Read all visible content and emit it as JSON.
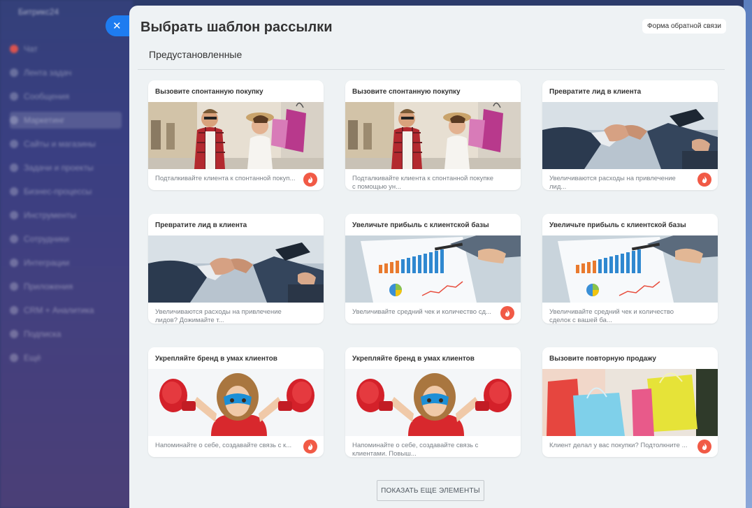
{
  "background_sidebar": {
    "title": "Битрикс24",
    "items": [
      "Чат",
      "Лента задач",
      "Сообщения",
      "Маркетинг",
      "Сайты и магазины",
      "Задачи и проекты",
      "Бизнес-процессы",
      "Инструменты",
      "Сотрудники",
      "Интеграции",
      "Приложения",
      "CRM + Аналитика",
      "Подписка",
      "Ещё"
    ]
  },
  "close_button": {
    "icon": "close-icon",
    "symbol": "✕"
  },
  "panel": {
    "title": "Выбрать шаблон рассылки",
    "feedback_label": "Форма обратной связи",
    "section_label": "Предустановленные",
    "accent_color": "#f15a46"
  },
  "templates": [
    {
      "title": "Вызовите спонтанную покупку",
      "description": "Подталкивайте клиента к спонтанной покуп...",
      "image": "shoppers"
    },
    {
      "title": "Вызовите спонтанную покупку",
      "description": "Подталкивайте клиента к спонтанной покупке с помощью ун...",
      "image": "shoppers"
    },
    {
      "title": "Превратите лид в клиента",
      "description": "Увеличиваются расходы на привлечение лид...",
      "image": "handshake"
    },
    {
      "title": "Превратите лид в клиента",
      "description": "Увеличиваются расходы на привлечение лидов? Дожимайте т...",
      "image": "handshake"
    },
    {
      "title": "Увеличьте прибыль с клиентской базы",
      "description": "Увеличивайте средний чек и количество сд...",
      "image": "charts"
    },
    {
      "title": "Увеличьте прибыль с клиентской базы",
      "description": "Увеличивайте средний чек и количество сделок с вашей ба...",
      "image": "charts"
    },
    {
      "title": "Укрепляйте бренд в умах клиентов",
      "description": "Напоминайте о себе, создавайте связь с к...",
      "image": "boxer"
    },
    {
      "title": "Укрепляйте бренд в умах клиентов",
      "description": "Напоминайте о себе, создавайте связь с клиентами. Повыш...",
      "image": "boxer"
    },
    {
      "title": "Вызовите повторную продажу",
      "description": "Клиент делал у вас покупки? Подтолкните ...",
      "image": "bags"
    }
  ],
  "show_more_label": "ПОКАЗАТЬ ЕЩЕ ЭЛЕМЕНТЫ"
}
